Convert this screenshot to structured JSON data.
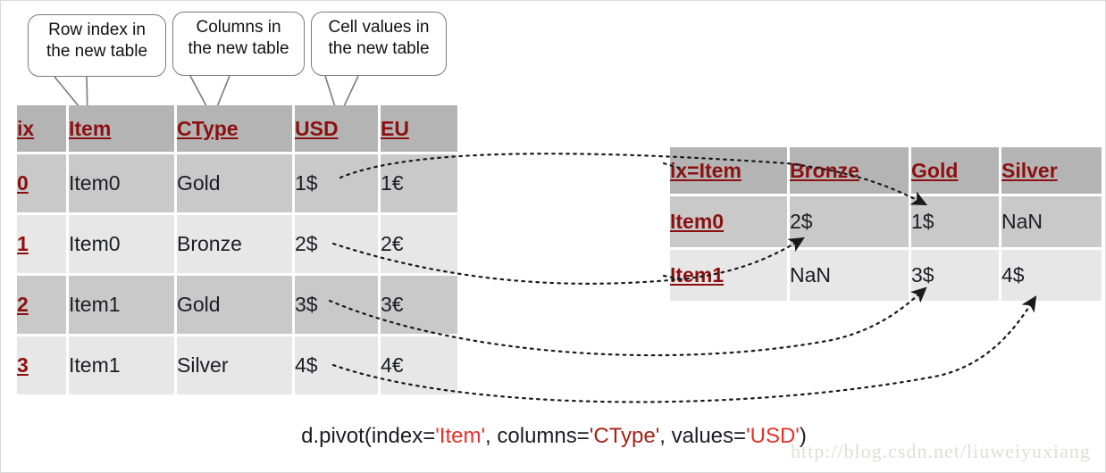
{
  "callouts": [
    {
      "name": "row-index-callout",
      "line1": "Row index in",
      "line2": "the new table"
    },
    {
      "name": "columns-callout",
      "line1": "Columns in",
      "line2": "the new table"
    },
    {
      "name": "cell-values-callout",
      "line1": "Cell values in",
      "line2": "the new table"
    }
  ],
  "source_table": {
    "headers": [
      "ix",
      "Item",
      "CType",
      "USD",
      "EU"
    ],
    "rows": [
      {
        "ix": "0",
        "Item": "Item0",
        "CType": "Gold",
        "USD": "1$",
        "EU": "1€"
      },
      {
        "ix": "1",
        "Item": "Item0",
        "CType": "Bronze",
        "USD": "2$",
        "EU": "2€"
      },
      {
        "ix": "2",
        "Item": "Item1",
        "CType": "Gold",
        "USD": "3$",
        "EU": "3€"
      },
      {
        "ix": "3",
        "Item": "Item1",
        "CType": "Silver",
        "USD": "4$",
        "EU": "4€"
      }
    ]
  },
  "pivot_table": {
    "headers": [
      "ix=Item",
      "Bronze",
      "Gold",
      "Silver"
    ],
    "rows": [
      {
        "ix": "Item0",
        "Bronze": "2$",
        "Gold": "1$",
        "Silver": "NaN"
      },
      {
        "ix": "Item1",
        "Bronze": "NaN",
        "Gold": "3$",
        "Silver": "4$"
      }
    ]
  },
  "caption": {
    "part1": "d.pivot(index=",
    "arg1": "'Item'",
    "part2": ", columns=",
    "arg2": "'CType'",
    "part3": ", values=",
    "arg3": "'USD'",
    "part4": ")"
  },
  "watermark": "http://blog.csdn.net/liuweiyuxiang",
  "colors": {
    "header_text": "#8c1010",
    "header_bg": "#b4b4b4",
    "row_bg": "#c9c9c9",
    "row_alt_bg": "#e7e7e7",
    "arrow": "#1a1a1a",
    "arg_red": "#e6302a",
    "arg_dark_red": "#a32318",
    "watermark": "#e0ddda"
  }
}
